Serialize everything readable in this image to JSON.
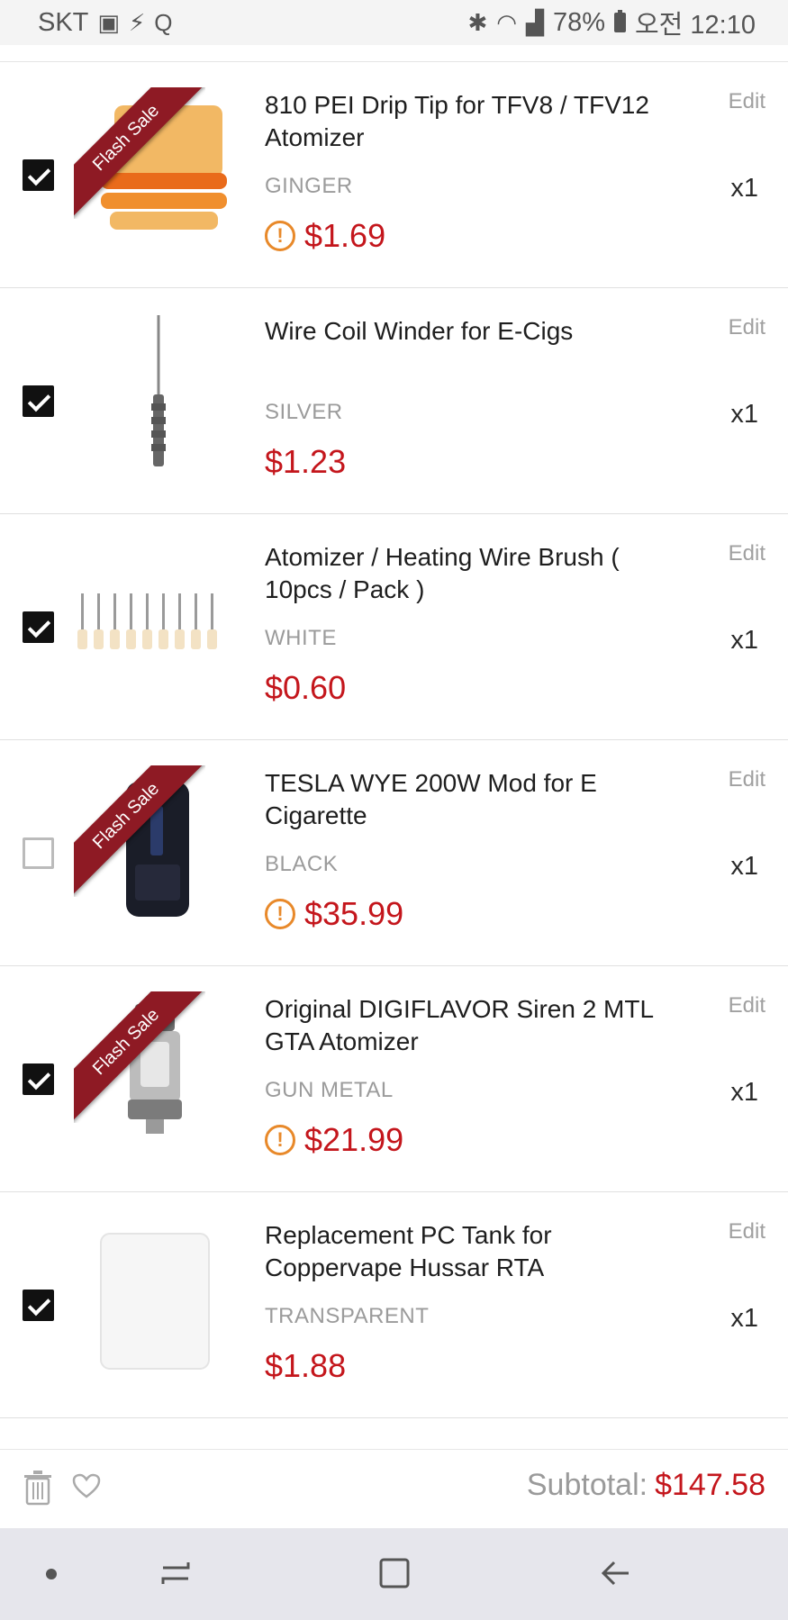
{
  "status_bar": {
    "carrier": "SKT",
    "battery": "78%",
    "time": "오전 12:10"
  },
  "items": [
    {
      "title": "810 PEI Drip Tip for TFV8 / TFV12 Atomizer",
      "color": "GINGER",
      "price": "$1.69",
      "edit": "Edit",
      "qty": "x1",
      "checked": true,
      "flash_sale": true,
      "warning": true,
      "ribbon": "Flash Sale"
    },
    {
      "title": "Wire Coil Winder for E-Cigs",
      "color": "SILVER",
      "price": "$1.23",
      "edit": "Edit",
      "qty": "x1",
      "checked": true,
      "flash_sale": false,
      "warning": false
    },
    {
      "title": "Atomizer / Heating Wire Brush ( 10pcs / Pack )",
      "color": "WHITE",
      "price": "$0.60",
      "edit": "Edit",
      "qty": "x1",
      "checked": true,
      "flash_sale": false,
      "warning": false
    },
    {
      "title": "TESLA WYE 200W Mod for E Cigarette",
      "color": "BLACK",
      "price": "$35.99",
      "edit": "Edit",
      "qty": "x1",
      "checked": false,
      "flash_sale": true,
      "warning": true,
      "ribbon": "Flash Sale"
    },
    {
      "title": "Original DIGIFLAVOR Siren 2 MTL GTA Atomizer",
      "color": "GUN METAL",
      "price": "$21.99",
      "edit": "Edit",
      "qty": "x1",
      "checked": true,
      "flash_sale": true,
      "warning": true,
      "ribbon": "Flash Sale"
    },
    {
      "title": "Replacement PC Tank for Coppervape Hussar RTA",
      "color": "TRANSPARENT",
      "price": "$1.88",
      "edit": "Edit",
      "qty": "x1",
      "checked": true,
      "flash_sale": false,
      "warning": false
    }
  ],
  "bottom_bar": {
    "subtotal_label": "Subtotal:",
    "subtotal_value": "$147.58"
  },
  "colors": {
    "price": "#c4161c",
    "warning": "#e8892a",
    "ribbon": "#8e1a24"
  }
}
